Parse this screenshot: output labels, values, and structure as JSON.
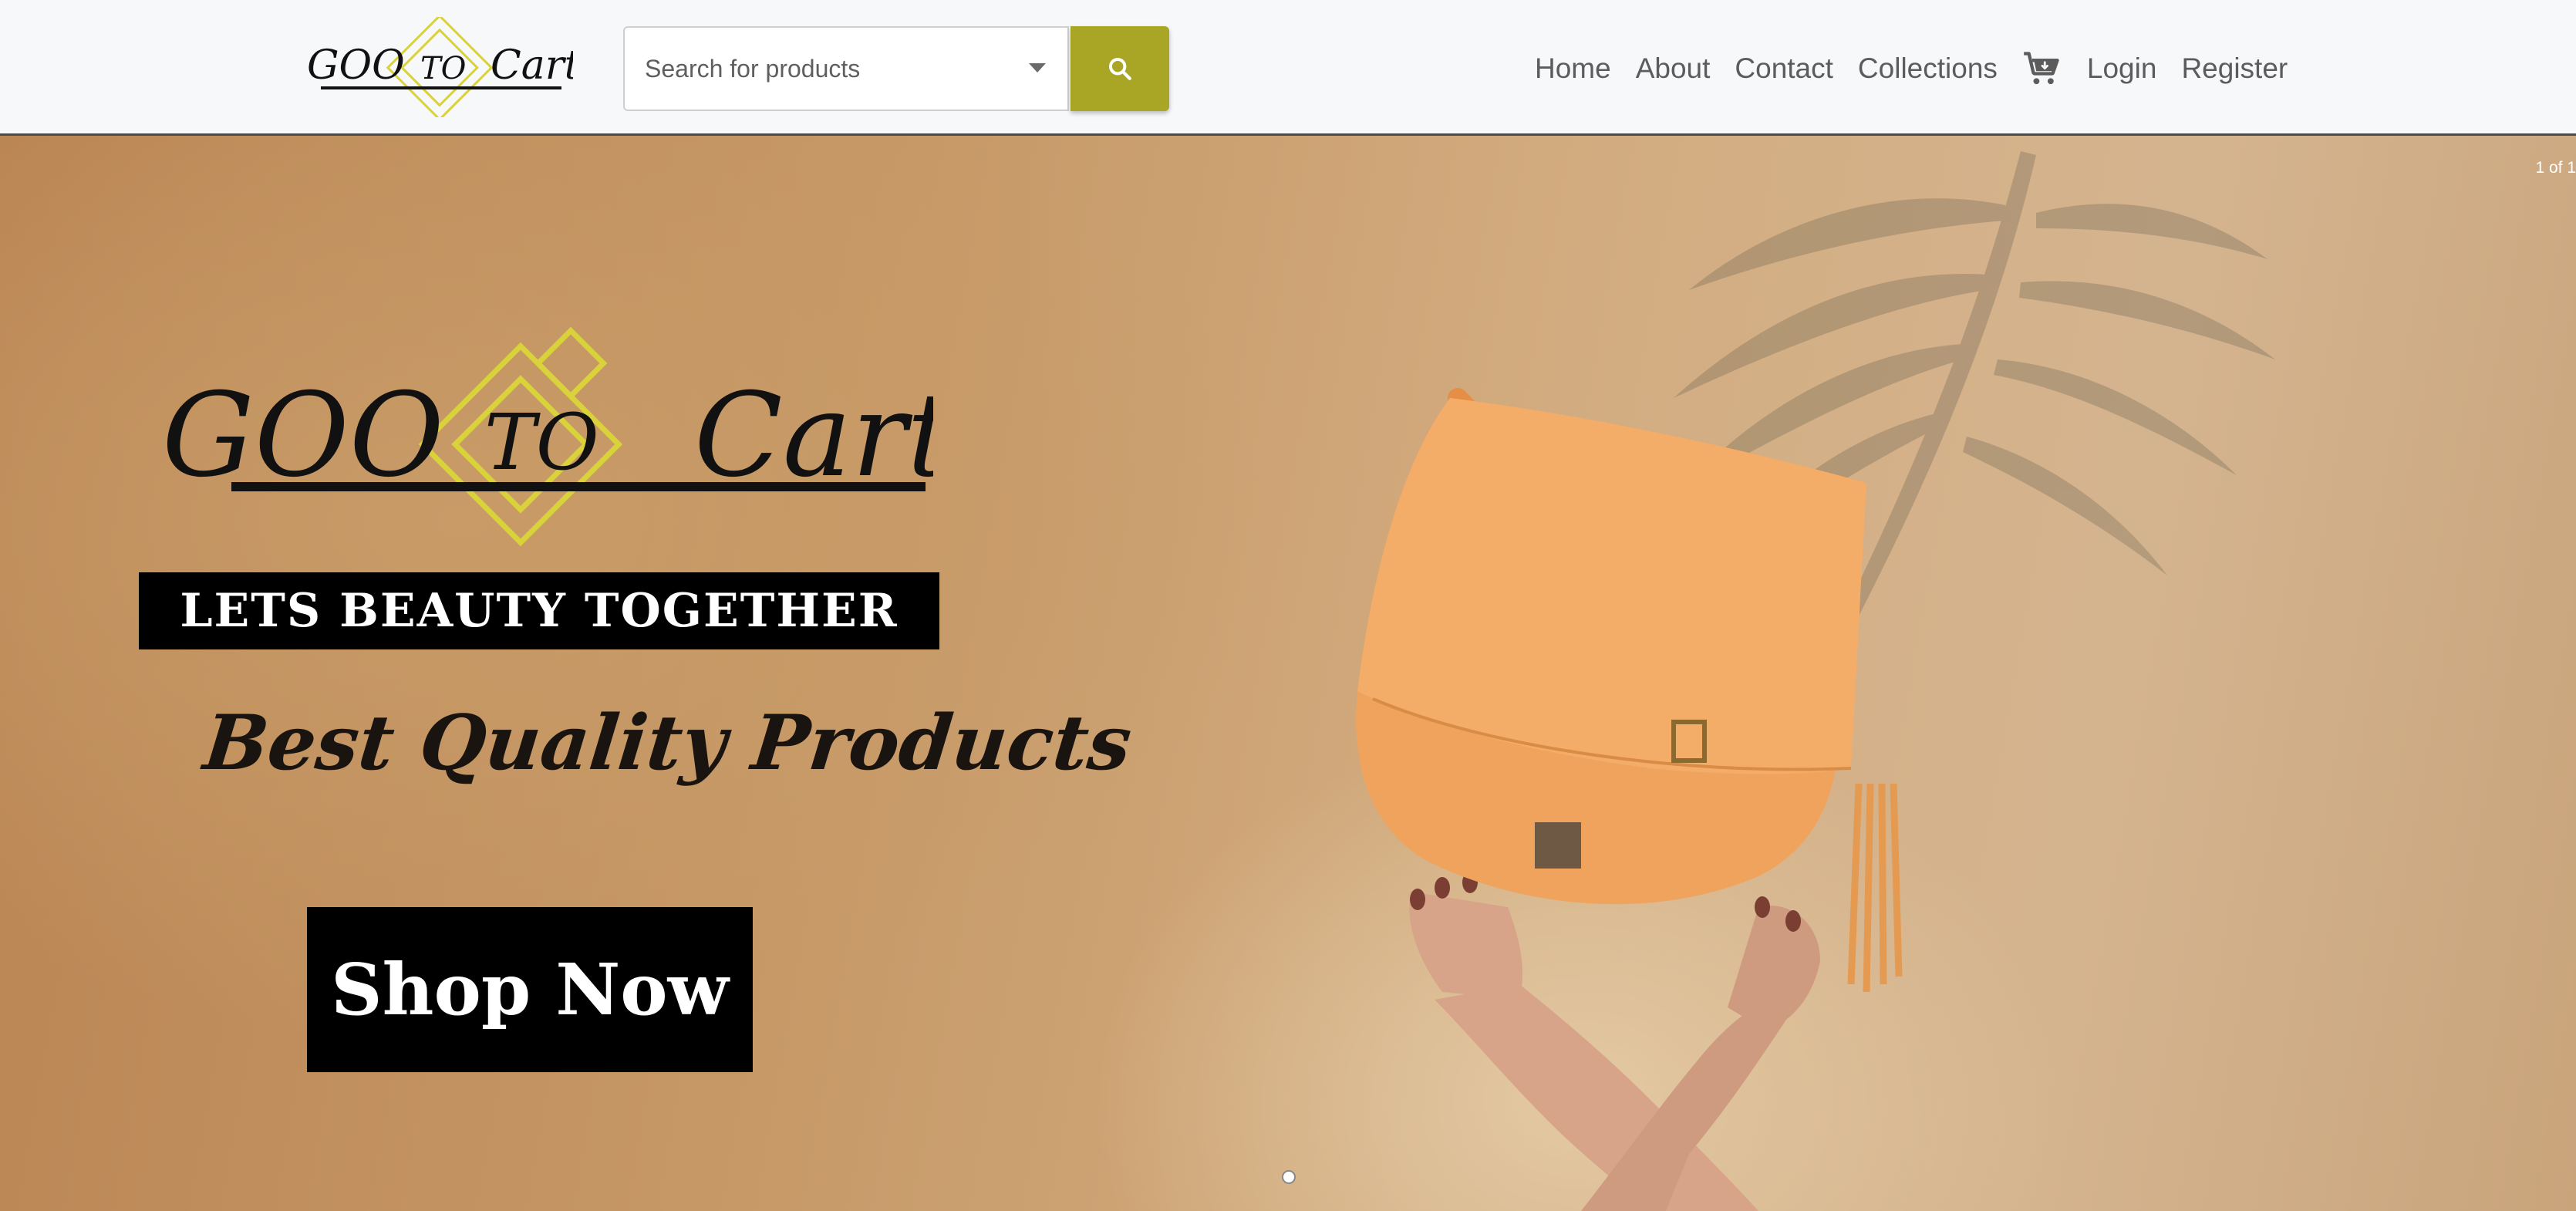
{
  "navbar": {
    "brand": {
      "word_left": "GOO",
      "word_middle": "TO",
      "word_right": "Cart"
    },
    "search": {
      "placeholder": "Search for products",
      "button_icon": "search-icon"
    },
    "links": [
      {
        "label": "Home"
      },
      {
        "label": "About"
      },
      {
        "label": "Contact"
      },
      {
        "label": "Collections"
      }
    ],
    "cart_icon": "cart-icon",
    "login_label": "Login",
    "register_label": "Register"
  },
  "hero": {
    "slide_counter": "1 of 1",
    "promo": {
      "logo": {
        "word_left": "GOO",
        "word_middle": "TO",
        "word_right": "Cart"
      },
      "tagline": "LETS BEAUTY TOGETHER",
      "headline": "Best Quality Products",
      "cta_label": "Shop Now"
    },
    "product_image": "orange-leather-saddle-bag-held-by-hands"
  },
  "colors": {
    "accent": "#a9a525",
    "logo_diamond": "#d9d23a",
    "nav_text": "#5c5c5c",
    "hero_background": "#c79a68",
    "bag": "#f0a35c"
  }
}
